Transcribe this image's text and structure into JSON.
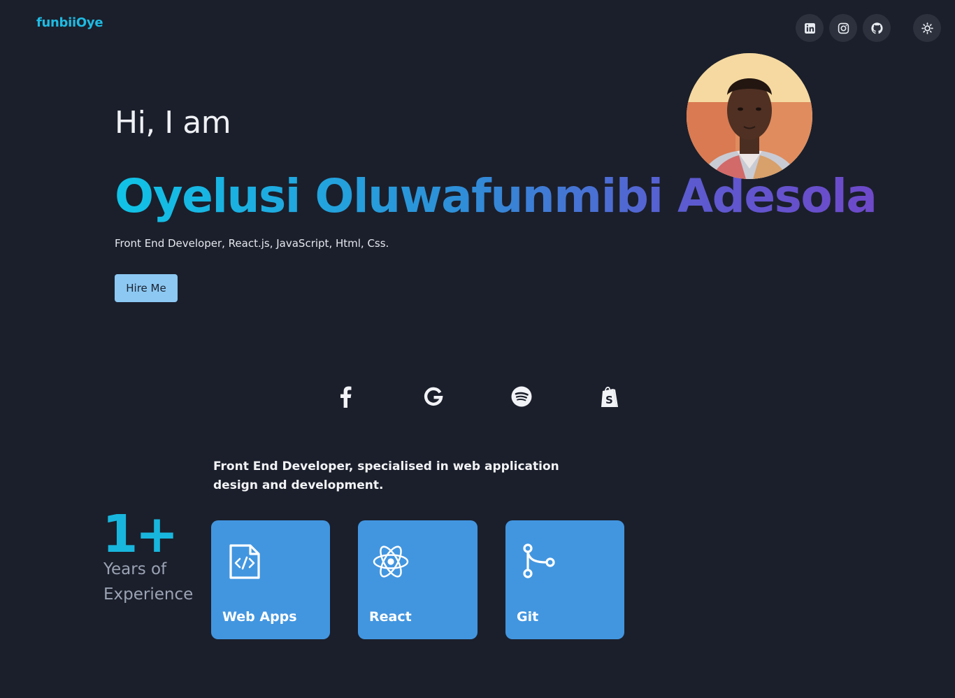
{
  "header": {
    "brand": "funbiiOye",
    "social": [
      {
        "icon": "linkedin-icon"
      },
      {
        "icon": "instagram-icon"
      },
      {
        "icon": "github-icon"
      }
    ],
    "theme_toggle": {
      "icon": "sun-icon"
    }
  },
  "hero": {
    "greeting": "Hi, I am",
    "name": "Oyelusi Oluwafunmibi Adesola",
    "tagline": "Front End Developer, React.js, JavaScript, Html, Css.",
    "cta_label": "Hire Me",
    "avatar": "profile-photo"
  },
  "clients": [
    {
      "icon": "facebook-icon"
    },
    {
      "icon": "google-icon"
    },
    {
      "icon": "spotify-icon"
    },
    {
      "icon": "shopify-icon"
    }
  ],
  "about": {
    "summary": "Front End Developer, specialised in web application design and development.",
    "years_value": "1+",
    "years_label_line1": "Years of",
    "years_label_line2": "Experience",
    "skills": [
      {
        "label": "Web Apps",
        "icon": "code-file-icon"
      },
      {
        "label": "React",
        "icon": "react-icon"
      },
      {
        "label": "Git",
        "icon": "git-branch-icon"
      }
    ]
  },
  "colors": {
    "background": "#1b1f2b",
    "accent": "#1ebbe3",
    "card": "#4296e0",
    "button": "#8cc8f2",
    "gradient_start": "#10c3e6",
    "gradient_end": "#6e49c9"
  }
}
